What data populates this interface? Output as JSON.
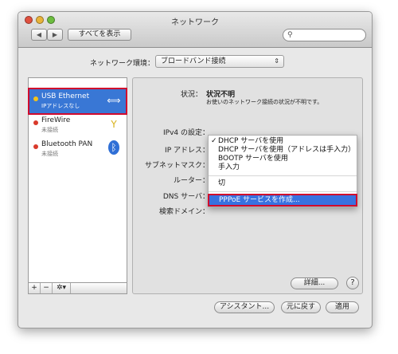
{
  "window": {
    "title": "ネットワーク"
  },
  "toolbar": {
    "back_label": "◀",
    "forward_label": "▶",
    "show_all_label": "すべてを表示",
    "search_value": "",
    "search_placeholder": ""
  },
  "location": {
    "label": "ネットワーク環境：",
    "value": "ブロードバンド接続"
  },
  "services": [
    {
      "name": "USB Ethernet",
      "status": "IPアドレスなし",
      "dot_color": "#f2c31b",
      "icon": "ethernet-icon"
    },
    {
      "name": "FireWire",
      "status": "未接続",
      "dot_color": "#d93a2b",
      "icon": "firewire-icon"
    },
    {
      "name": "Bluetooth PAN",
      "status": "未接続",
      "dot_color": "#d93a2b",
      "icon": "bluetooth-icon"
    }
  ],
  "sidebar_buttons": {
    "add": "+",
    "remove": "−",
    "gear": "✲▾"
  },
  "detail": {
    "status_label": "状況：",
    "status_value": "状況不明",
    "status_desc": "お使いのネットワーク接続の状況が不明です。",
    "ipv4_label": "IPv4 の設定：",
    "ip_label": "IP アドレス：",
    "subnet_label": "サブネットマスク：",
    "router_label": "ルーター：",
    "dns_label": "DNS サーバ：",
    "search_domain_label": "検索ドメイン："
  },
  "menu": {
    "items": [
      "DHCP サーバを使用",
      "DHCP サーバを使用（アドレスは手入力）",
      "BOOTP サーバを使用",
      "手入力"
    ],
    "checked": "✓",
    "off": "切",
    "pppoe": "PPPoE サービスを作成..."
  },
  "buttons": {
    "advanced": "詳細...",
    "help": "?",
    "assistant": "アシスタント...",
    "revert": "元に戻す",
    "apply": "適用"
  },
  "colors": {
    "highlight": "#3872e0",
    "annotation_red": "#d10a2d"
  }
}
